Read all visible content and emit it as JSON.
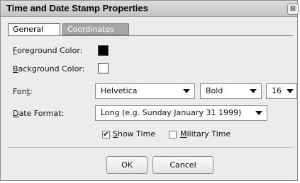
{
  "window": {
    "title": "Time and Date Stamp Properties",
    "close_glyph": "⊠"
  },
  "tabs": [
    {
      "label": "General",
      "active": true
    },
    {
      "label": "Coordinates",
      "active": false
    }
  ],
  "fields": {
    "foreground": {
      "mnemonic": "F",
      "rest": "oreground Color:",
      "color": "#000000"
    },
    "background": {
      "mnemonic": "B",
      "rest": "ackground Color:",
      "color": "#ffffff"
    },
    "font": {
      "pre": "Fon",
      "mnemonic": "t",
      "rest": ":",
      "family": "Helvetica",
      "style": "Bold",
      "size": "16"
    },
    "date_format": {
      "mnemonic": "D",
      "rest": "ate Format:",
      "value": "Long (e.g. Sunday January 31 1999)"
    }
  },
  "options": {
    "show_time": {
      "mnemonic": "S",
      "rest": "how Time",
      "checked": true,
      "check_glyph": "✔"
    },
    "military_time": {
      "mnemonic": "M",
      "rest": "ilitary Time",
      "checked": false
    }
  },
  "buttons": {
    "ok": "OK",
    "cancel": "Cancel"
  }
}
